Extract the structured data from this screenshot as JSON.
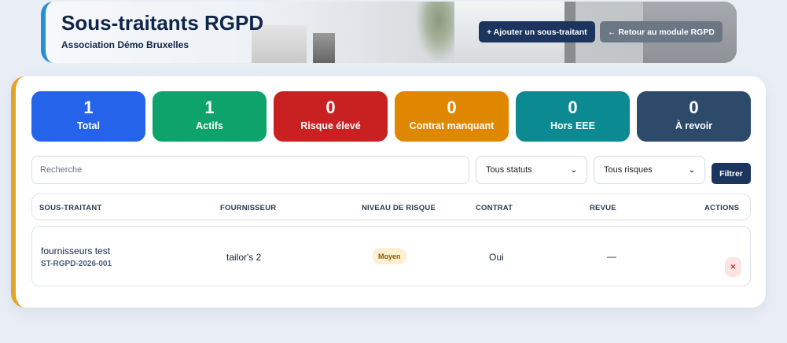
{
  "header": {
    "title": "Sous-traitants RGPD",
    "subtitle": "Association Démo Bruxelles",
    "add_button": "+ Ajouter un sous-traitant",
    "back_button": "← Retour au module RGPD",
    "accent_color": "#2a8fd1"
  },
  "stats": [
    {
      "value": "1",
      "label": "Total",
      "color": "#2563eb"
    },
    {
      "value": "1",
      "label": "Actifs",
      "color": "#0ea36b"
    },
    {
      "value": "0",
      "label": "Risque élevé",
      "color": "#c92121"
    },
    {
      "value": "0",
      "label": "Contrat manquant",
      "color": "#e08700"
    },
    {
      "value": "0",
      "label": "Hors EEE",
      "color": "#0b8a92"
    },
    {
      "value": "0",
      "label": "À revoir",
      "color": "#2e4a6b"
    }
  ],
  "filters": {
    "search_placeholder": "Recherche",
    "status_selected": "Tous statuts",
    "risk_selected": "Tous risques",
    "filter_button": "Filtrer"
  },
  "table": {
    "columns": [
      "SOUS-TRAITANT",
      "FOURNISSEUR",
      "NIVEAU DE RISQUE",
      "CONTRAT",
      "REVUE",
      "ACTIONS"
    ],
    "rows": [
      {
        "name": "fournisseurs test",
        "reference": "ST-RGPD-2026-001",
        "supplier": "tailor's 2",
        "risk": "Moyen",
        "contract": "Oui",
        "review": "—",
        "delete_icon": "×"
      }
    ]
  }
}
